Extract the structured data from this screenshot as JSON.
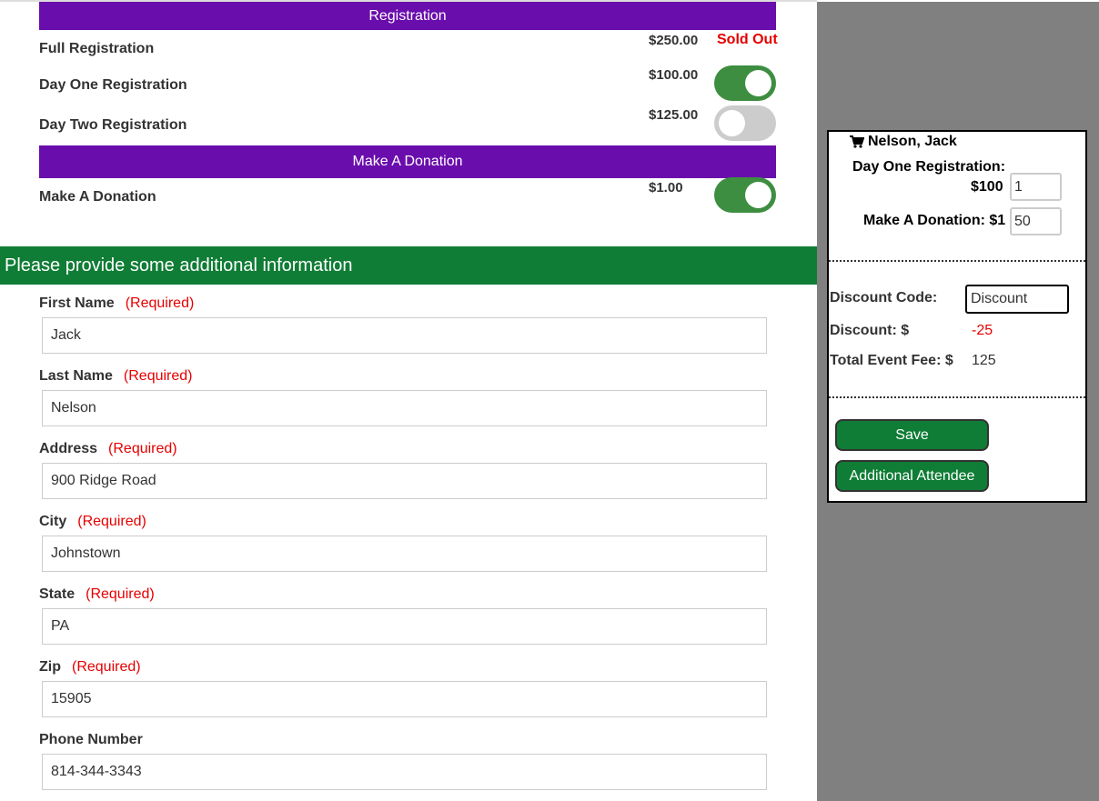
{
  "registration": {
    "header": "Registration",
    "items": [
      {
        "label": "Full Registration",
        "price": "$250.00",
        "status": "Sold Out"
      },
      {
        "label": "Day One Registration",
        "price": "$100.00",
        "selected": true
      },
      {
        "label": "Day Two Registration",
        "price": "$125.00",
        "selected": false
      }
    ]
  },
  "donation": {
    "header": "Make A Donation",
    "items": [
      {
        "label": "Make A Donation",
        "price": "$1.00",
        "selected": true
      }
    ]
  },
  "form": {
    "banner": "Please provide some additional information",
    "required_text": "(Required)",
    "fields": [
      {
        "label": "First Name",
        "value": "Jack",
        "required": true
      },
      {
        "label": "Last Name",
        "value": "Nelson",
        "required": true
      },
      {
        "label": "Address",
        "value": "900 Ridge Road",
        "required": true
      },
      {
        "label": "City",
        "value": "Johnstown",
        "required": true
      },
      {
        "label": "State",
        "value": "PA",
        "required": true
      },
      {
        "label": "Zip",
        "value": "15905",
        "required": true
      },
      {
        "label": "Phone Number",
        "value": "814-344-3343",
        "required": false
      }
    ]
  },
  "cart": {
    "icon": "shopping-cart-icon",
    "attendee": "Nelson, Jack",
    "items": [
      {
        "label": "Day One Registration:",
        "price": "$100",
        "qty": "1"
      },
      {
        "label": "Make A Donation: $1",
        "qty": "50"
      }
    ],
    "discount_code_label": "Discount Code:",
    "discount_code_value": "Discount",
    "discount_label": "Discount: $",
    "discount_value": "-25",
    "total_label": "Total Event Fee: $",
    "total_value": "125",
    "save_label": "Save",
    "additional_attendee_label": "Additional Attendee"
  },
  "colors": {
    "section_header": "#6a0dad",
    "banner": "#0f7d35",
    "toggle_on": "#3e8e41",
    "toggle_off": "#cccccc",
    "required": "#e60000",
    "sidebar_bg": "#808080"
  }
}
